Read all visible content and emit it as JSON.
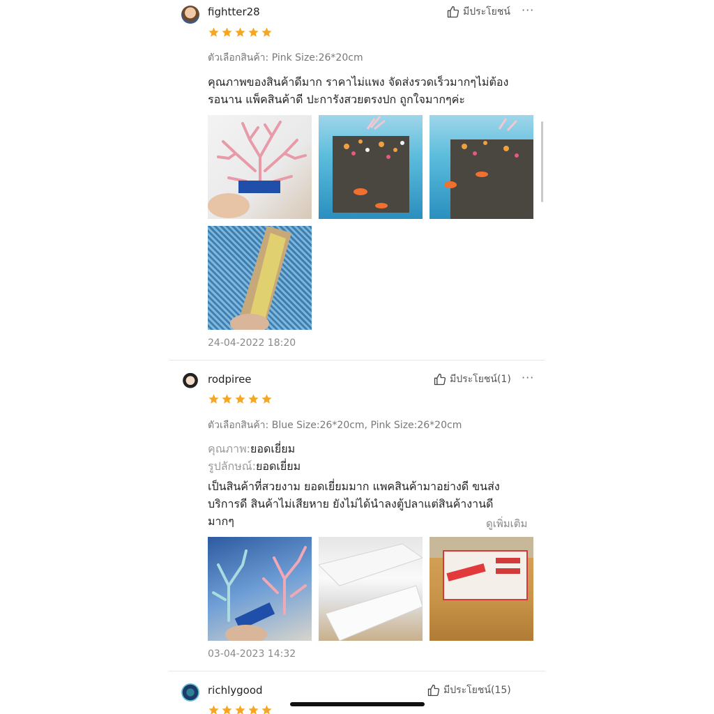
{
  "reviews": [
    {
      "username": "fightter28",
      "helpful_label": "มีประโยชน์",
      "more_label": "···",
      "rating": 5,
      "variant": "ตัวเลือกสินค้า: Pink Size:26*20cm",
      "comment_lines": [
        "คุณภาพของสินค้าดีมาก ราคาไม่แพง จัดส่งรวดเร็วมากๆไม่ต้อง",
        "รอนาน แพ็คสินค้าดี ปะการังสวยตรงปก ถูกใจมากๆค่ะ"
      ],
      "photos": [
        "pink-coral-in-hand-photo",
        "aquarium-with-fish-photo",
        "aquarium-with-fish-closeup-photo",
        "coral-package-in-box-photo"
      ],
      "date": "24-04-2022 18:20"
    },
    {
      "username": "rodpiree",
      "helpful_label": "มีประโยชน์(1)",
      "more_label": "···",
      "rating": 5,
      "variant": "ตัวเลือกสินค้า: Blue Size:26*20cm, Pink Size:26*20cm",
      "quality_key": "คุณภาพ:",
      "quality_val": "ยอดเยี่ยม",
      "appearance_key": "รูปลักษณ์:",
      "appearance_val": "ยอดเยี่ยม",
      "comment_lines": [
        "เป็นสินค้าที่สวยงาม ยอดเยี่ยมมาก แพคสินค้ามาอย่างดี ขนส่ง",
        "บริการดี สินค้าไม่เสียหาย ยังไม่ได้นำลงตู้ปลาแต่สินค้างานดี",
        "มากๆ"
      ],
      "see_more": "ดูเพิ่มเติม",
      "photos": [
        "blue-and-pink-coral-photo",
        "foam-packaging-photo",
        "shipping-box-photo"
      ],
      "date": "03-04-2023 14:32"
    },
    {
      "username": "richlygood",
      "helpful_label": "มีประโยชน์(15)",
      "rating": 5
    }
  ],
  "colors": {
    "star": "#f6a623",
    "divider": "#e6e6e6"
  }
}
